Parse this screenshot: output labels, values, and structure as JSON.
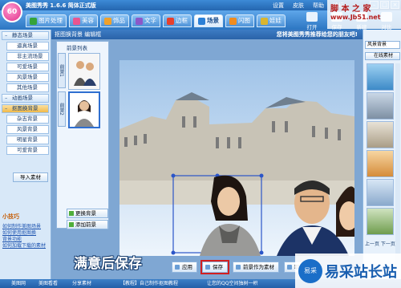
{
  "app": {
    "logo_text": "60",
    "title": "美图秀秀 1.6.6 简体正式版"
  },
  "top_menu": [
    "设置",
    "皮肤",
    "帮助",
    "论坛"
  ],
  "tabs": [
    {
      "label": "图片处理",
      "color": "#35a33a"
    },
    {
      "label": "美容",
      "color": "#e9558f"
    },
    {
      "label": "饰品",
      "color": "#f0a12b"
    },
    {
      "label": "文字",
      "color": "#8b58c8"
    },
    {
      "label": "边框",
      "color": "#e6402d"
    },
    {
      "label": "场景",
      "color": "#2b80d6"
    },
    {
      "label": "闪图",
      "color": "#f08c1e"
    },
    {
      "label": "娃娃",
      "color": "#d9b52f"
    }
  ],
  "tools": [
    "打开",
    "保存",
    "新建",
    "对比"
  ],
  "left_panel": {
    "categories": [
      {
        "label": "静态场景",
        "type": "head"
      },
      {
        "label": "逼真场景",
        "type": "sub"
      },
      {
        "label": "非主流场景",
        "type": "sub"
      },
      {
        "label": "可爱场景",
        "type": "sub"
      },
      {
        "label": "风景场景",
        "type": "sub"
      },
      {
        "label": "其他场景",
        "type": "sub"
      },
      {
        "label": "动画场景",
        "type": "head"
      },
      {
        "label": "抠图换背景",
        "type": "head-sel"
      },
      {
        "label": "杂志背景",
        "type": "sub"
      },
      {
        "label": "风景背景",
        "type": "sub"
      },
      {
        "label": "明星背景",
        "type": "sub"
      },
      {
        "label": "可爱背景",
        "type": "sub"
      }
    ],
    "import_label": "导入素材",
    "tip_title": "小技巧",
    "tip_links": [
      "如何制作美图场景",
      "如何使用抠图换",
      "背景功能",
      "如何加载下载的素材"
    ]
  },
  "editor": {
    "header_title": "抠图换背景  编辑框",
    "header_tip": "您将美图秀秀推荐给您的朋友吧!",
    "material_title": "前景列表",
    "tabs": [
      "前景1",
      "前景2"
    ],
    "side_buttons": [
      "更换背景",
      "添加前景"
    ],
    "bottom_buttons": [
      "应用",
      "保存",
      "前景作为素材",
      "取消"
    ],
    "saved_label": "保存"
  },
  "caption": "满意后保存",
  "right_panel": {
    "select_value": "风景背景",
    "online_label": "在线素材",
    "footer": "上一页 下一页"
  },
  "status": {
    "items": [
      "美图网",
      "美图看看",
      "分享素材",
      "【教程】自己制作抠图教程",
      "让您的QQ空间独树一帜"
    ]
  },
  "watermarks": {
    "top_line1": "脚 本 之 家",
    "top_line2": "www.Jb51.net",
    "br_text": "易采站长站",
    "br_logo": "易采"
  }
}
